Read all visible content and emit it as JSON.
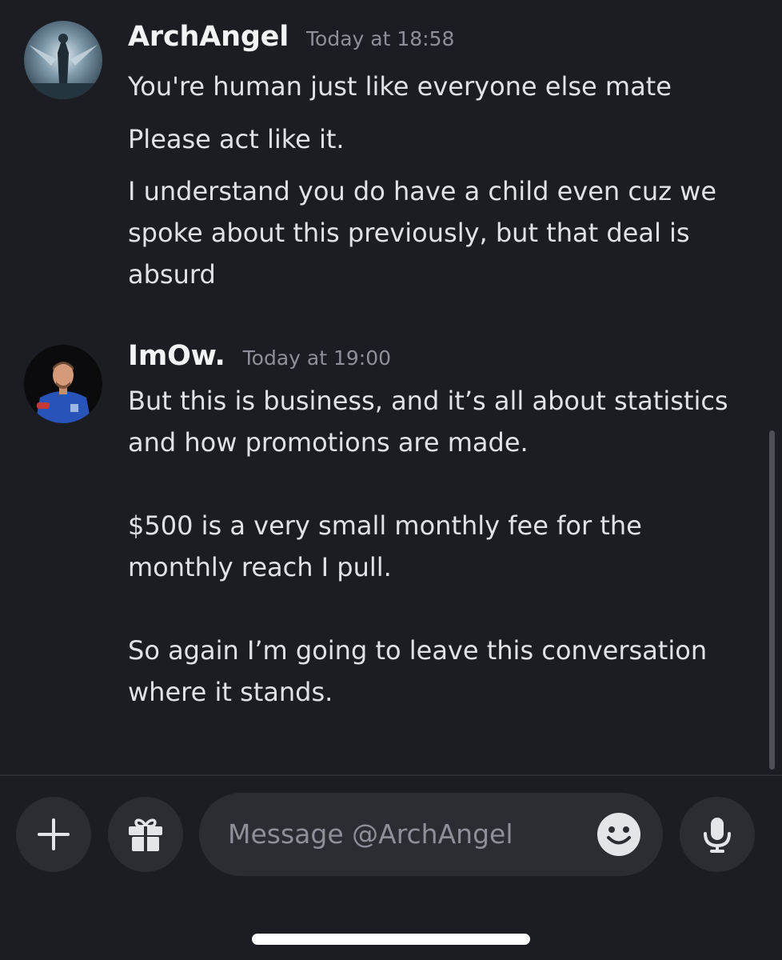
{
  "messages": [
    {
      "author": "ArchAngel",
      "timestamp": "Today at 18:58",
      "lines": [
        "You're human just like everyone else mate",
        "Please act like it.",
        "I understand you do have a child even cuz we",
        "spoke about this previously, but that deal is",
        "absurd"
      ]
    },
    {
      "author": "ImOw.",
      "timestamp": "Today at 19:00",
      "lines": [
        "But this is business, and it’s all about statistics",
        "and how promotions are made.",
        "$500 is a very small monthly fee for the",
        "monthly reach I pull.",
        "So again I’m going to leave this conversation",
        "where it stands."
      ]
    }
  ],
  "composer": {
    "placeholder": "Message @ArchAngel",
    "add_icon": "plus-icon",
    "gift_icon": "gift-icon",
    "emoji_icon": "smiley-icon",
    "voice_icon": "microphone-icon"
  },
  "colors": {
    "background": "#1c1d22",
    "input_background": "#2b2d33",
    "text": "#e1e2e6",
    "muted": "#8e9099"
  }
}
